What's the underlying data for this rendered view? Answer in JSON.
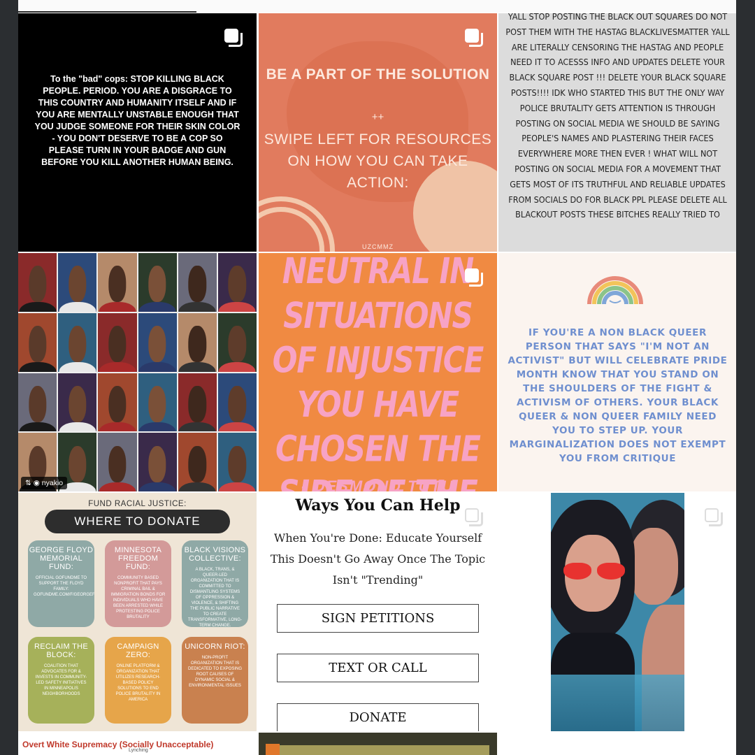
{
  "tiles": {
    "t1": {
      "text": "To the \"bad\" cops: STOP KILLING BLACK PEOPLE. PERIOD. YOU ARE A DISGRACE TO THIS COUNTRY AND HUMANITY ITSELF AND IF YOU ARE MENTALLY UNSTABLE ENOUGH THAT YOU JUDGE SOMEONE FOR THEIR SKIN COLOR - YOU DON'T DESERVE TO BE A COP SO PLEASE TURN IN YOUR BADGE AND GUN BEFORE YOU KILL ANOTHER HUMAN BEING."
    },
    "t2": {
      "heading": "BE A PART OF THE SOLUTION",
      "plus": "++",
      "body": "SWIPE LEFT FOR RESOURCES ON HOW YOU CAN TAKE ACTION:",
      "brand": "UZCMMZ"
    },
    "t3": {
      "text": "Yall stop posting the black out squares do not post them with the hastag blacklivesmatter yall are literally censoring the hastag and people need it to acesss info and updates delete your black square post !!! delete your black square posts!!!! idk who started this but the only way police brutality gets attention is through posting on social media we should be saying people's names and plastering their faces everywhere more then ever ! what will not posting on social media for a movement that gets most of its truthful and reliable updates from socials do for black ppl please delete all blackout posts these bitches really tried to"
    },
    "t4": {
      "repost_user": "nyakio"
    },
    "t5": {
      "quote": "NEUTRAL IN SITUATIONS OF INJUSTICE YOU HAVE CHOSEN THE SIDE OF THE OPPRESSOR.",
      "author": "- DESMOND TUTU"
    },
    "t6": {
      "text": "If you're a non black queer person that says \"I'm not an activist\" but will celebrate PRIDE MONTH know that you stand on the shoulders of the fight & activism of others. Your black queer & non queer family need you to step up. Your marginalization does not exempt you from critique"
    },
    "t7": {
      "heading": "FUND RACIAL JUSTICE:",
      "title": "WHERE TO DONATE",
      "cards": [
        {
          "title": "GEORGE FLOYD MEMORIAL FUND:",
          "desc": "OFFICIAL GOFUNDME TO SUPPORT THE FLOYD FAMILY: GOFUNDME.COM/F/GEORGEFLOYD",
          "color": "#8fa9a6"
        },
        {
          "title": "MINNESOTA FREEDOM FUND:",
          "desc": "COMMUNITY BASED NONPROFIT THAT PAYS CRIMINAL BAIL & IMMIGRATION BONDS FOR INDIVIDUALS WHO HAVE BEEN ARRESTED WHILE PROTESTING POLICE BRUTALITY",
          "color": "#d39a99"
        },
        {
          "title": "BLACK VISIONS COLLECTIVE:",
          "desc": "A BLACK, TRANS, & QUEER-LED ORGANIZATION THAT IS COMMITTED TO DISMANTLING SYSTEMS OF OPPRESSION & VIOLENCE, & SHIFTING THE PUBLIC NARRATIVE TO CREATE TRANSFORMATIVE, LONG-TERM CHANGE.",
          "color": "#8fa9a6"
        },
        {
          "title": "RECLAIM THE BLOCK:",
          "desc": "COALITION THAT ADVOCATES FOR & INVESTS IN COMMUNITY-LED SAFETY INITIATIVES IN MINNEAPOLIS NEIGHBORHOODS",
          "color": "#a6b15a"
        },
        {
          "title": "CAMPAIGN ZERO:",
          "desc": "ONLINE PLATFORM & ORGANIZATION THAT UTILIZES RESEARCH-BASED POLICY SOLUTIONS TO END POLICE BRUTALITY IN AMERICA",
          "color": "#e6a54a"
        },
        {
          "title": "UNICORN RIOT:",
          "desc": "NON-PROFIT ORGANIZATION THAT IS DEDICATED TO EXPOSING ROOT CAUSES OF DYNAMIC SOCIAL & ENVIRONMENTAL ISSUES",
          "color": "#c9814f"
        }
      ]
    },
    "t8": {
      "title": "Ways You Can Help",
      "subtitle": "When You're Done: Educate Yourself This Doesn't Go Away Once The Topic Isn't \"Trending\"",
      "buttons": [
        "SIGN PETITIONS",
        "TEXT OR CALL",
        "DONATE"
      ]
    },
    "b1": {
      "title": "Overt White Supremacy (Socially Unacceptable)",
      "side": "Lynching"
    }
  },
  "icons": {
    "multi_post": "carousel-icon",
    "repost": "repost-icon"
  },
  "colors": {
    "background": "#2b2e31",
    "t2_bg": "#e17b5e",
    "t5_bg": "#f08a42",
    "t5_text": "#f7a3c5",
    "t6_text": "#6f8fcf"
  }
}
